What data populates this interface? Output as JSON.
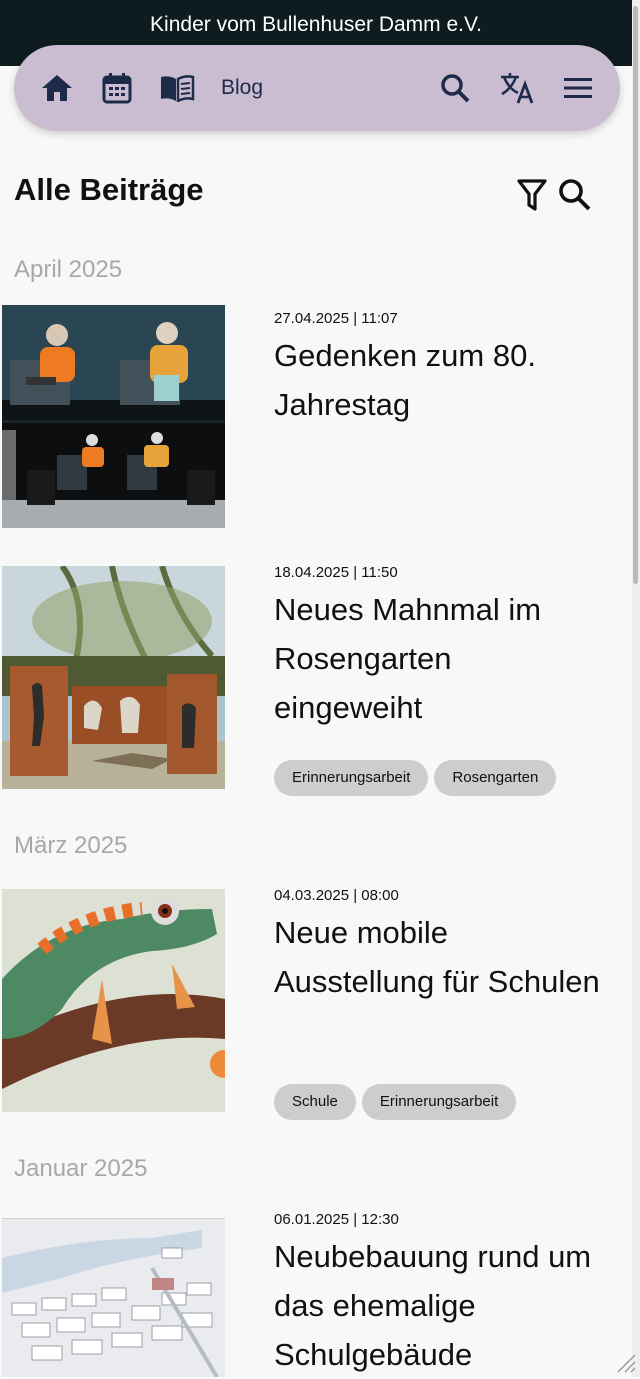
{
  "site": {
    "org_name": "Kinder vom Bullenhuser Damm e.V."
  },
  "nav": {
    "icons": [
      "home-icon",
      "calendar-icon",
      "book-icon",
      "search-icon",
      "translate-icon",
      "menu-icon"
    ],
    "blog_label": "Blog"
  },
  "page": {
    "title": "Alle Beiträge",
    "tools": [
      "filter-icon",
      "search-icon"
    ]
  },
  "months": [
    "April 2025",
    "März 2025",
    "Januar 2025"
  ],
  "posts": [
    {
      "date": "27.04.2025 | 11:07",
      "title": "Gedenken zum 80. Jahrestag",
      "tags": []
    },
    {
      "date": "18.04.2025 | 11:50",
      "title": "Neues Mahnmal im Rosengarten eingeweiht",
      "tags": [
        "Erinnerungsarbeit",
        "Rosengarten"
      ]
    },
    {
      "date": "04.03.2025 | 08:00",
      "title": "Neue mobile Ausstellung für Schulen",
      "tags": [
        "Schule",
        "Erinnerungsarbeit"
      ]
    },
    {
      "date": "06.01.2025 | 12:30",
      "title": "Neubebauung rund um das ehemalige Schulgebäude",
      "tags": []
    }
  ],
  "colors": {
    "header_bg": "#0e1c1f",
    "nav_bg": "#cbbdd1",
    "icon": "#1e2a4a",
    "tag_bg": "#cdcdcd",
    "month_text": "#a8a8a8"
  }
}
